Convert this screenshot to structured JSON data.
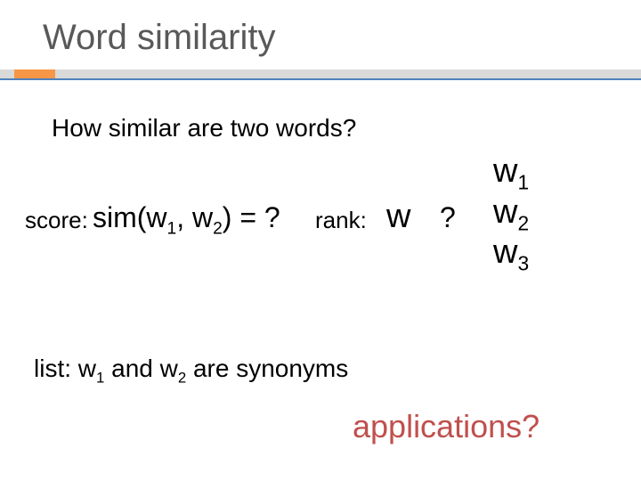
{
  "title": "Word similarity",
  "subline": "How similar are two words?",
  "score": {
    "label": "score:",
    "func": "sim(w₁, w₂) = ?"
  },
  "rank": {
    "label": "rank:",
    "w": "w",
    "q": "?",
    "items": [
      "w₁",
      "w₂",
      "w₃"
    ]
  },
  "list": {
    "text": "list: w₁ and w₂ are synonyms"
  },
  "applications": "applications?"
}
